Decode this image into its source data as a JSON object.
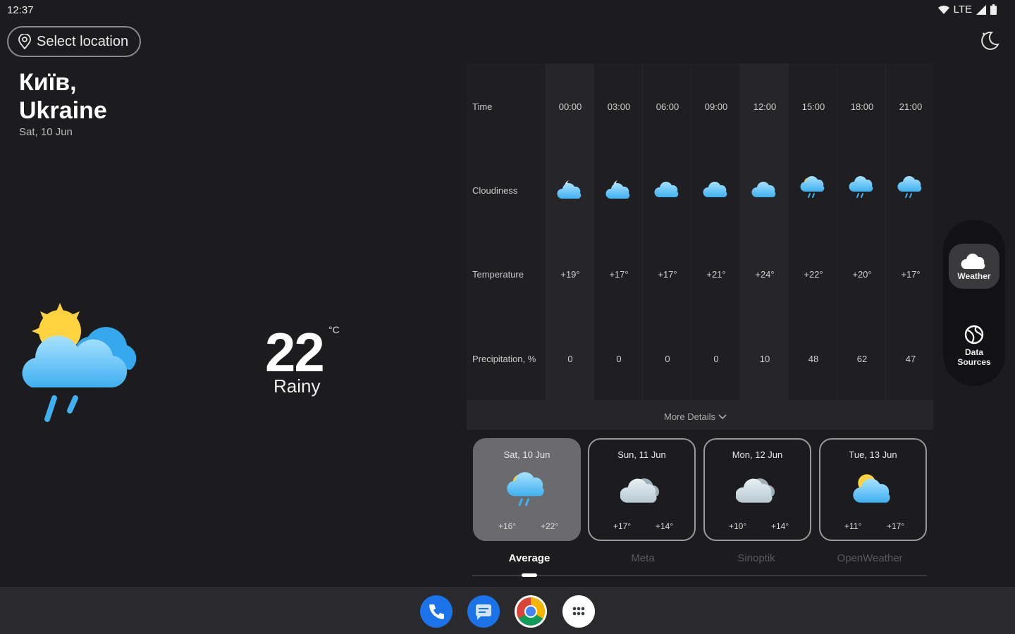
{
  "status": {
    "time": "12:37",
    "network": "LTE"
  },
  "location_button": {
    "label": "Select location"
  },
  "city": {
    "line1": "Київ,",
    "line2": "Ukraine",
    "date": "Sat, 10 Jun"
  },
  "current": {
    "temperature": "22",
    "unit": "°C",
    "condition": "Rainy"
  },
  "table": {
    "labels": {
      "time": "Time",
      "cloudiness": "Cloudiness",
      "temperature": "Temperature",
      "precipitation": "Precipitation, %"
    },
    "times": [
      "00:00",
      "03:00",
      "06:00",
      "09:00",
      "12:00",
      "15:00",
      "18:00",
      "21:00"
    ],
    "cloudiness_icons": [
      "moon-cloud-icon",
      "moon-cloud-icon",
      "cloud-icon",
      "cloud-icon",
      "cloud-icon",
      "sun-cloud-rain-icon",
      "cloud-rain-icon",
      "cloud-rain-icon"
    ],
    "temperatures": [
      "+19°",
      "+17°",
      "+17°",
      "+21°",
      "+24°",
      "+22°",
      "+20°",
      "+17°"
    ],
    "precipitation": [
      "0",
      "0",
      "0",
      "0",
      "10",
      "48",
      "62",
      "47"
    ],
    "more_details": "More Details"
  },
  "days": [
    {
      "label": "Sat, 10 Jun",
      "min": "+16°",
      "max": "+22°",
      "icon": "sun-cloud-rain-icon"
    },
    {
      "label": "Sun, 11 Jun",
      "min": "+17°",
      "max": "+14°",
      "icon": "cloud-icon"
    },
    {
      "label": "Mon, 12 Jun",
      "min": "+10°",
      "max": "+14°",
      "icon": "cloud-icon"
    },
    {
      "label": "Tue, 13 Jun",
      "min": "+11°",
      "max": "+17°",
      "icon": "sun-cloud-icon"
    }
  ],
  "tabs": [
    "Average",
    "Meta",
    "Sinoptik",
    "OpenWeather"
  ],
  "rail": {
    "weather": "Weather",
    "sources": "Data Sources"
  },
  "dock": [
    "phone-app-icon",
    "messages-app-icon",
    "chrome-app-icon",
    "app-drawer-icon"
  ],
  "colors": {
    "background": "#1c1c1e",
    "cloud": "#5cc3f5",
    "sun": "#ffd23f",
    "panel": "#262628"
  }
}
